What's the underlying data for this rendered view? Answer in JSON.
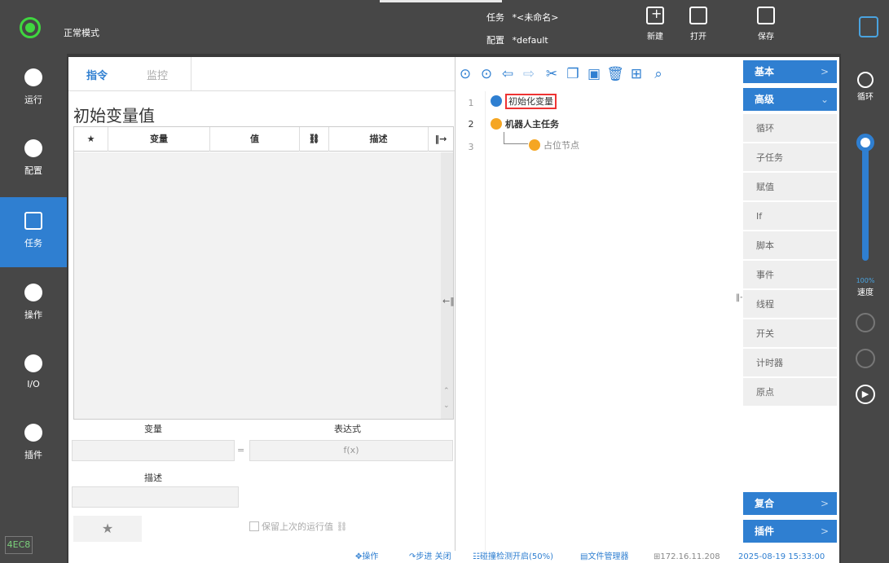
{
  "topbar": {
    "mode": "正常模式",
    "task_label": "任务",
    "task_value": "*<未命名>",
    "config_label": "配置",
    "config_value": "*default",
    "buttons": [
      {
        "icon": "new-file-icon",
        "label": "新建"
      },
      {
        "icon": "open-mail-icon",
        "label": "打开"
      },
      {
        "icon": "save-icon",
        "label": "保存"
      }
    ]
  },
  "sidebar": {
    "items": [
      {
        "icon": "run-icon",
        "label": "运行"
      },
      {
        "icon": "gear-icon",
        "label": "配置"
      },
      {
        "icon": "code-window-icon",
        "label": "任务",
        "active": true
      },
      {
        "icon": "move-arrows-icon",
        "label": "操作"
      },
      {
        "icon": "io-arrows-icon",
        "label": "I/O"
      },
      {
        "icon": "plugin-cube-icon",
        "label": "插件"
      }
    ],
    "version": "4EC8"
  },
  "left_panel": {
    "tabs": [
      "指令",
      "监控"
    ],
    "title": "初始变量值",
    "table_headers": [
      "★",
      "变量",
      "值",
      "",
      "描述"
    ],
    "form": {
      "variable_label": "变量",
      "expression_label": "表达式",
      "expression_placeholder": "f(x)",
      "equals": "=",
      "description_label": "描述",
      "star": "★",
      "keep_value_label": "保留上次的运行值"
    }
  },
  "tree": {
    "lines": [
      {
        "num": "1",
        "label": "初始化变量",
        "selected": true
      },
      {
        "num": "2",
        "label": "机器人主任务"
      },
      {
        "num": "3",
        "label": "占位节点"
      }
    ]
  },
  "categories": {
    "basic": "基本",
    "advanced": "高级",
    "items": [
      "循环",
      "子任务",
      "赋值",
      "If",
      "脚本",
      "事件",
      "线程",
      "开关",
      "计时器",
      "原点"
    ],
    "composite": "复合",
    "plugin": "插件"
  },
  "rightbar": {
    "loop_label": "循环",
    "speed_value": "100%",
    "speed_label": "速度"
  },
  "status": {
    "operate": "操作",
    "step": "步进 关闭",
    "collision": "碰撞检测开启(50%)",
    "file_manager": "文件管理器",
    "ip": "172.16.11.208",
    "datetime": "2025-08-19 15:33:00"
  },
  "colors": {
    "accent": "#2f7fd1",
    "topbar": "#474747",
    "mode_green": "#3fd63f",
    "selection_red": "#e33333",
    "node_orange": "#f5a623"
  }
}
